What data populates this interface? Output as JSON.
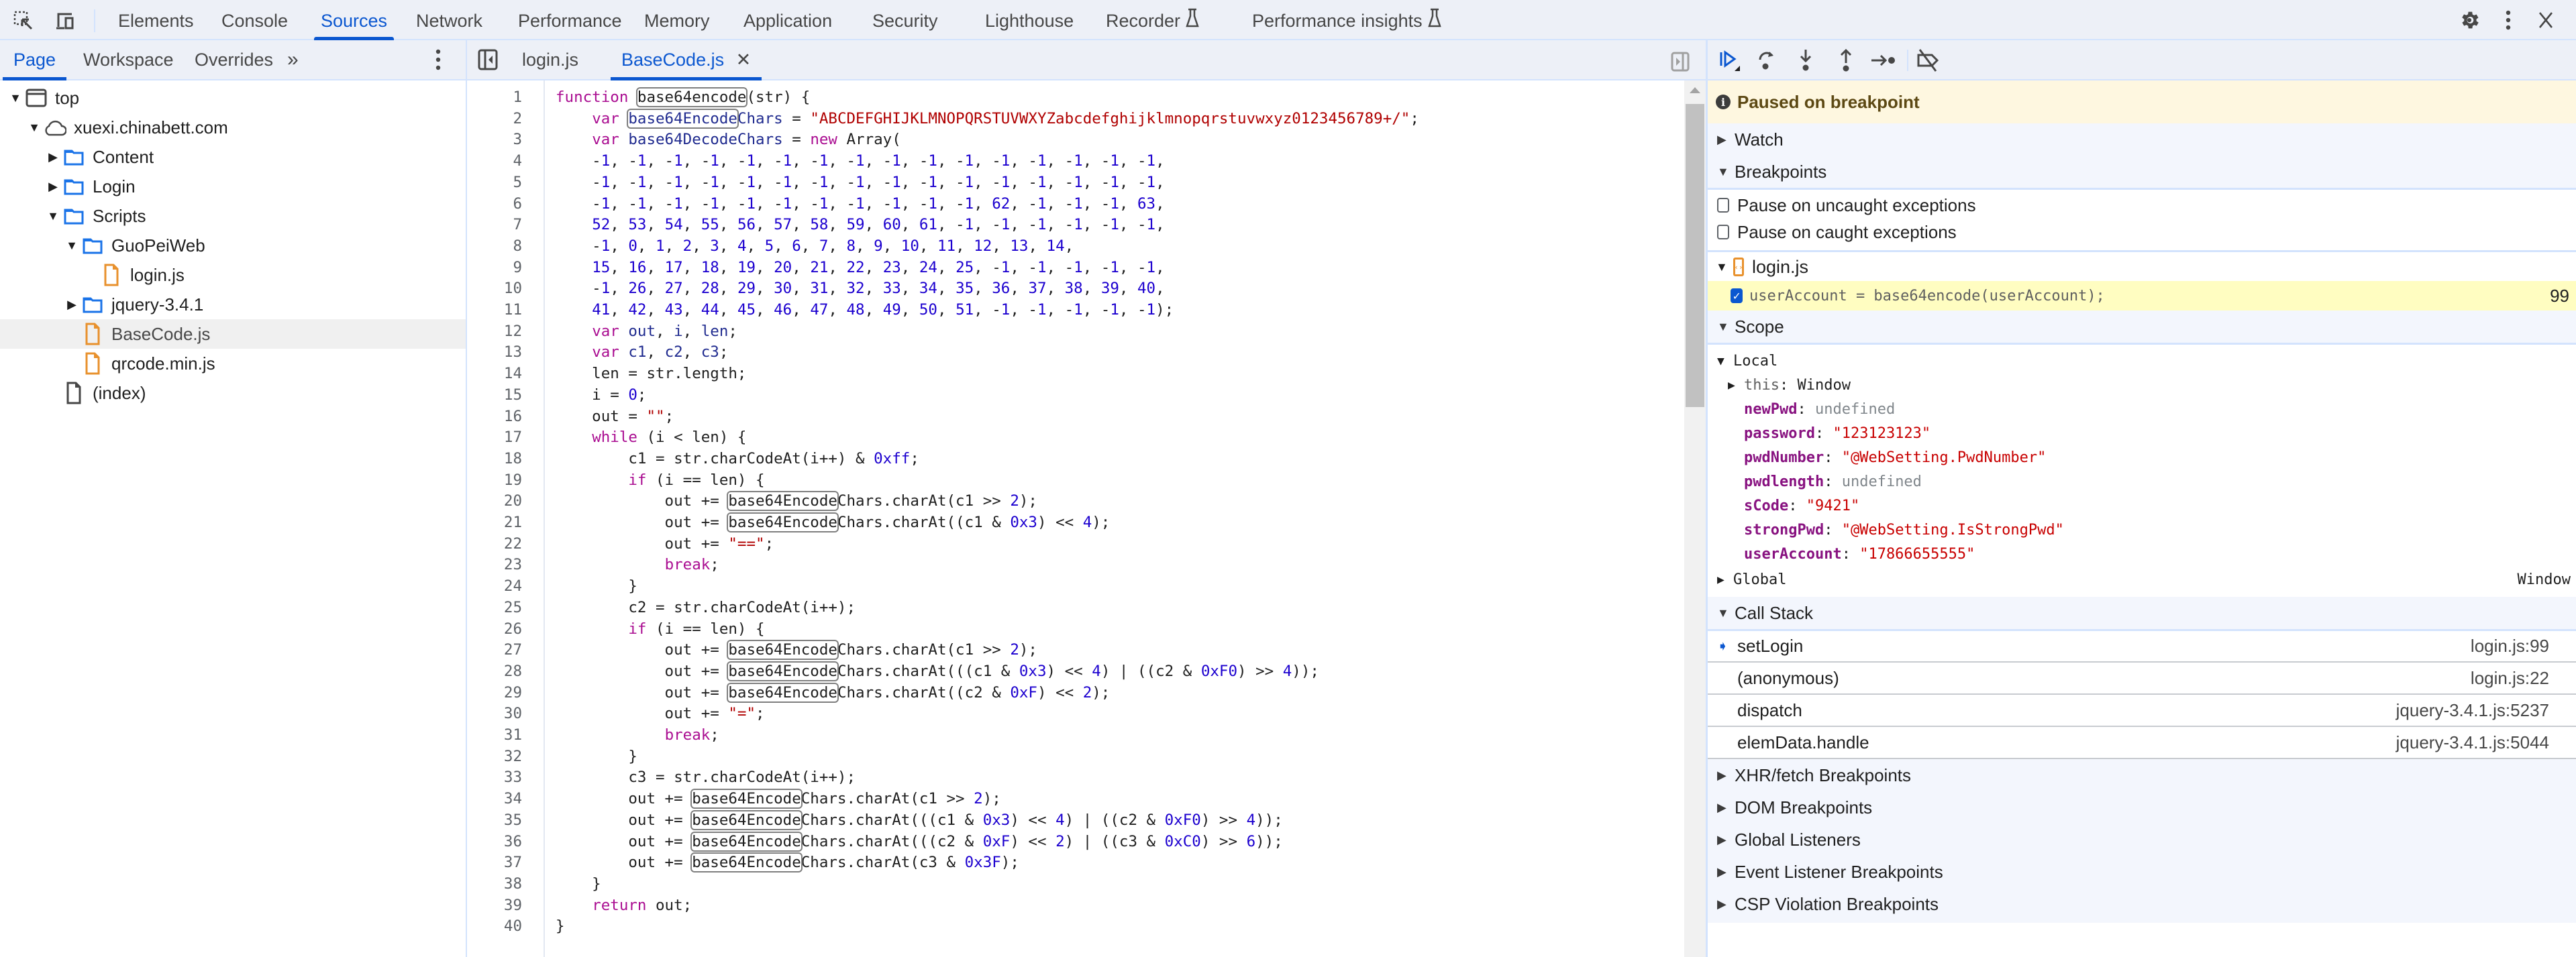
{
  "toolbar": {
    "inspect_icon": "inspect-element-icon",
    "device_icon": "device-toolbar-icon",
    "tabs": [
      {
        "label": "Elements",
        "active": false
      },
      {
        "label": "Console",
        "active": false
      },
      {
        "label": "Sources",
        "active": true
      },
      {
        "label": "Network",
        "active": false
      },
      {
        "label": "Performance",
        "active": false
      },
      {
        "label": "Memory",
        "active": false
      },
      {
        "label": "Application",
        "active": false
      },
      {
        "label": "Security",
        "active": false
      },
      {
        "label": "Lighthouse",
        "active": false
      },
      {
        "label": "Recorder",
        "active": false,
        "experimental": true
      },
      {
        "label": "Performance insights",
        "active": false,
        "experimental": true
      }
    ],
    "right_icons": [
      "gear-icon",
      "more-vert-icon",
      "close-icon"
    ]
  },
  "navigator": {
    "tabs": [
      {
        "label": "Page",
        "active": true
      },
      {
        "label": "Workspace",
        "active": false
      },
      {
        "label": "Overrides",
        "active": false
      }
    ],
    "more_tabs": "»",
    "tree": [
      {
        "label": "top",
        "type": "frame",
        "expanded": true,
        "depth": 0
      },
      {
        "label": "xuexi.chinabett.com",
        "type": "domain",
        "expanded": true,
        "depth": 1
      },
      {
        "label": "Content",
        "type": "folder",
        "expanded": false,
        "depth": 2
      },
      {
        "label": "Login",
        "type": "folder",
        "expanded": false,
        "depth": 2
      },
      {
        "label": "Scripts",
        "type": "folder",
        "expanded": true,
        "depth": 2
      },
      {
        "label": "GuoPeiWeb",
        "type": "folder",
        "expanded": true,
        "depth": 3
      },
      {
        "label": "login.js",
        "type": "js",
        "depth": 4
      },
      {
        "label": "jquery-3.4.1",
        "type": "folder",
        "expanded": false,
        "depth": 3
      },
      {
        "label": "BaseCode.js",
        "type": "js",
        "depth": 3,
        "selected": true
      },
      {
        "label": "qrcode.min.js",
        "type": "js",
        "depth": 3
      },
      {
        "label": "(index)",
        "type": "doc",
        "depth": 2
      }
    ]
  },
  "editor": {
    "tabs": [
      {
        "label": "login.js",
        "active": false
      },
      {
        "label": "BaseCode.js",
        "active": true,
        "closable": true
      }
    ],
    "close_glyph": "✕",
    "lines": [
      "function base64encode(str) {",
      "    var base64EncodeChars = \"ABCDEFGHIJKLMNOPQRSTUVWXYZabcdefghijklmnopqrstuvwxyz0123456789+/\";",
      "    var base64DecodeChars = new Array(",
      "    -1, -1, -1, -1, -1, -1, -1, -1, -1, -1, -1, -1, -1, -1, -1, -1,",
      "    -1, -1, -1, -1, -1, -1, -1, -1, -1, -1, -1, -1, -1, -1, -1, -1,",
      "    -1, -1, -1, -1, -1, -1, -1, -1, -1, -1, -1, 62, -1, -1, -1, 63,",
      "    52, 53, 54, 55, 56, 57, 58, 59, 60, 61, -1, -1, -1, -1, -1, -1,",
      "    -1, 0, 1, 2, 3, 4, 5, 6, 7, 8, 9, 10, 11, 12, 13, 14,",
      "    15, 16, 17, 18, 19, 20, 21, 22, 23, 24, 25, -1, -1, -1, -1, -1,",
      "    -1, 26, 27, 28, 29, 30, 31, 32, 33, 34, 35, 36, 37, 38, 39, 40,",
      "    41, 42, 43, 44, 45, 46, 47, 48, 49, 50, 51, -1, -1, -1, -1, -1);",
      "    var out, i, len;",
      "    var c1, c2, c3;",
      "    len = str.length;",
      "    i = 0;",
      "    out = \"\";",
      "    while (i < len) {",
      "        c1 = str.charCodeAt(i++) & 0xff;",
      "        if (i == len) {",
      "            out += base64EncodeChars.charAt(c1 >> 2);",
      "            out += base64EncodeChars.charAt((c1 & 0x3) << 4);",
      "            out += \"==\";",
      "            break;",
      "        }",
      "        c2 = str.charCodeAt(i++);",
      "        if (i == len) {",
      "            out += base64EncodeChars.charAt(c1 >> 2);",
      "            out += base64EncodeChars.charAt(((c1 & 0x3) << 4) | ((c2 & 0xF0) >> 4));",
      "            out += base64EncodeChars.charAt((c2 & 0xF) << 2);",
      "            out += \"=\";",
      "            break;",
      "        }",
      "        c3 = str.charCodeAt(i++);",
      "        out += base64EncodeChars.charAt(c1 >> 2);",
      "        out += base64EncodeChars.charAt(((c1 & 0x3) << 4) | ((c2 & 0xF0) >> 4));",
      "        out += base64EncodeChars.charAt(((c2 & 0xF) << 2) | ((c3 & 0xC0) >> 6));",
      "        out += base64EncodeChars.charAt(c3 & 0x3F);",
      "    }",
      "    return out;",
      "}"
    ],
    "search_highlight": "base64encode",
    "search_highlight_ci": true
  },
  "debugger": {
    "controls": [
      {
        "icon": "resume-icon",
        "active": true
      },
      {
        "icon": "step-over-icon"
      },
      {
        "icon": "step-into-icon"
      },
      {
        "icon": "step-out-icon"
      },
      {
        "icon": "step-icon"
      },
      {
        "icon": "deactivate-breakpoints-icon"
      }
    ],
    "paused_message": "Paused on breakpoint",
    "sections": {
      "watch": "Watch",
      "breakpoints": "Breakpoints",
      "scope": "Scope",
      "call_stack": "Call Stack",
      "xhr": "XHR/fetch Breakpoints",
      "dom": "DOM Breakpoints",
      "global_listeners": "Global Listeners",
      "event_listener": "Event Listener Breakpoints",
      "csp": "CSP Violation Breakpoints"
    },
    "pause_uncaught": {
      "label": "Pause on uncaught exceptions",
      "checked": false
    },
    "pause_caught": {
      "label": "Pause on caught exceptions",
      "checked": false
    },
    "breakpoint_file": "login.js",
    "breakpoint": {
      "code": "userAccount = base64encode(userAccount);",
      "line": "99",
      "checked": true
    },
    "scope": {
      "local_label": "Local",
      "this_key": "this",
      "this_value": "Window",
      "vars": [
        {
          "key": "newPwd",
          "value": "undefined",
          "kind": "undef"
        },
        {
          "key": "password",
          "value": "\"123123123\"",
          "kind": "str"
        },
        {
          "key": "pwdNumber",
          "value": "\"@WebSetting.PwdNumber\"",
          "kind": "str"
        },
        {
          "key": "pwdlength",
          "value": "undefined",
          "kind": "undef"
        },
        {
          "key": "sCode",
          "value": "\"9421\"",
          "kind": "str"
        },
        {
          "key": "strongPwd",
          "value": "\"@WebSetting.IsStrongPwd\"",
          "kind": "str"
        },
        {
          "key": "userAccount",
          "value": "\"17866655555\"",
          "kind": "str"
        }
      ],
      "global_label": "Global",
      "global_value": "Window"
    },
    "call_stack": [
      {
        "name": "setLogin",
        "location": "login.js:99",
        "current": true
      },
      {
        "name": "(anonymous)",
        "location": "login.js:22"
      },
      {
        "name": "dispatch",
        "location": "jquery-3.4.1.js:5237"
      },
      {
        "name": "elemData.handle",
        "location": "jquery-3.4.1.js:5044"
      }
    ]
  },
  "colors": {
    "accent": "#0b57d0",
    "keyword": "#aa0d91",
    "string": "#b00000",
    "number": "#1c00cf",
    "paused_banner": "#fef7e0",
    "breakpoint_row": "#fffdc1",
    "file_icon": "#e8912d"
  }
}
